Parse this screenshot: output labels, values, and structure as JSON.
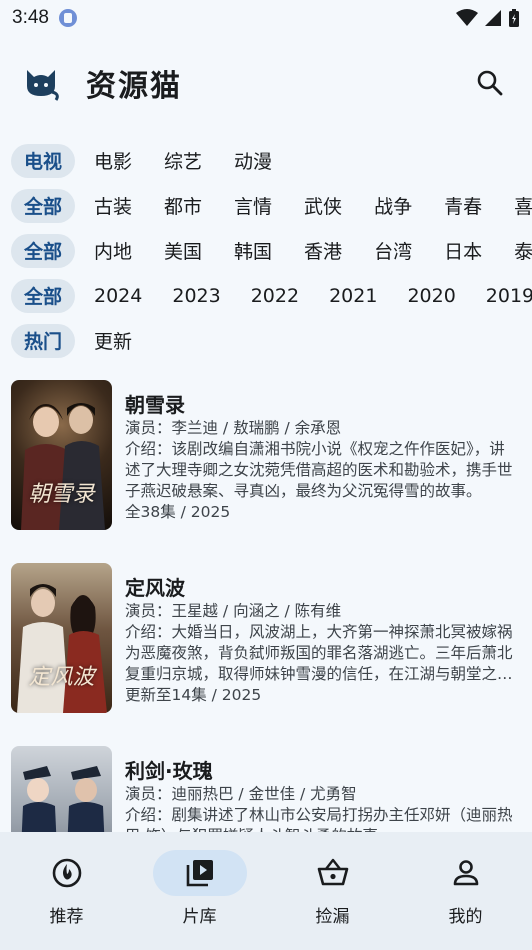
{
  "status": {
    "time": "3:48"
  },
  "header": {
    "title": "资源猫"
  },
  "filters": [
    {
      "chip": "电视",
      "options": [
        "电影",
        "综艺",
        "动漫"
      ]
    },
    {
      "chip": "全部",
      "options": [
        "古装",
        "都市",
        "言情",
        "武侠",
        "战争",
        "青春",
        "喜"
      ]
    },
    {
      "chip": "全部",
      "options": [
        "内地",
        "美国",
        "韩国",
        "香港",
        "台湾",
        "日本",
        "泰"
      ]
    },
    {
      "chip": "全部",
      "options": [
        "2024",
        "2023",
        "2022",
        "2021",
        "2020",
        "2019"
      ]
    },
    {
      "chip": "热门",
      "options": [
        "更新"
      ]
    }
  ],
  "shows": [
    {
      "title": "朝雪录",
      "cast": "演员：李兰迪 / 敖瑞鹏 / 余承恩",
      "desc": "介绍：该剧改编自潇湘书院小说《权宠之仵作医妃》，讲述了大理寺卿之女沈菀凭借高超的医术和勘验术，携手世子燕迟破悬案、寻真凶，最终为父沉冤得雪的故事。",
      "meta": "全38集 / 2025",
      "poster_text": "朝雪录"
    },
    {
      "title": "定风波",
      "cast": "演员：王星越 / 向涵之 / 陈有维",
      "desc": "介绍：大婚当日，风波湖上，大齐第一神探萧北冥被嫁祸为恶魔夜煞，背负弑师叛国的罪名落湖逃亡。三年后萧北复重归京城，取得师妹钟雪漫的信任，在江湖与朝堂之间追查真相。",
      "meta": "更新至14集 / 2025",
      "poster_text": "定风波"
    },
    {
      "title": "利剑·玫瑰",
      "cast": "演员：迪丽热巴 / 金世佳 / 尤勇智",
      "desc": "介绍：剧集讲述了林山市公安局打拐办主任邓妍（迪丽热巴 饰）与犯罪嫌疑人斗智斗勇的故事。",
      "meta": "",
      "poster_text": ""
    }
  ],
  "nav": [
    {
      "label": "推荐",
      "icon": "recommend-icon",
      "active": false
    },
    {
      "label": "片库",
      "icon": "library-icon",
      "active": true
    },
    {
      "label": "捡漏",
      "icon": "basket-icon",
      "active": false
    },
    {
      "label": "我的",
      "icon": "person-icon",
      "active": false
    }
  ],
  "colors": {
    "accent": "#1a4f8a",
    "chip_bg": "#dde6ee",
    "background": "#f4f8fc",
    "nav_bg": "#e8eef4",
    "nav_active": "#d2e3f4"
  }
}
